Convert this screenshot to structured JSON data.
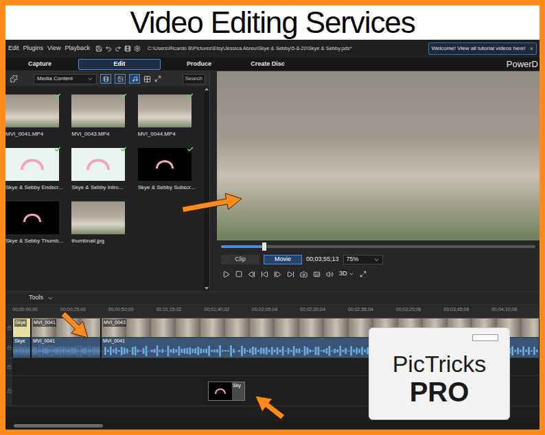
{
  "banner": {
    "title": "Video Editing Services"
  },
  "menu": [
    "Edit",
    "Plugins",
    "View",
    "Playback"
  ],
  "project_path": "C:\\Users\\Ricardo B\\Pictures\\Etsy\\Jessica Abreu\\Skye & Sebby\\5-8-20\\Skye & Sebby.pds*",
  "notification": {
    "text": "Welcome! View all tutorial videos here!",
    "close": "×"
  },
  "tabs": [
    {
      "label": "Capture",
      "selected": false
    },
    {
      "label": "Edit",
      "selected": true
    },
    {
      "label": "Produce",
      "selected": false
    },
    {
      "label": "Create Disc",
      "selected": false
    }
  ],
  "brand": "PowerD",
  "library": {
    "dropdown": "Media Content",
    "search": "Search",
    "items": [
      {
        "label": "MVI_0041.MP4",
        "kind": "photo",
        "checked": true
      },
      {
        "label": "MVI_0043.MP4",
        "kind": "photo",
        "checked": true
      },
      {
        "label": "MVI_0044.MP4",
        "kind": "photo",
        "checked": true
      },
      {
        "label": "Skye & Sebby Endscr...",
        "kind": "light",
        "checked": true
      },
      {
        "label": "Skye & Sebby Intro...",
        "kind": "light",
        "checked": true
      },
      {
        "label": "Skye & Sebby Subscr...",
        "kind": "dark",
        "checked": true
      },
      {
        "label": "Skye & Sebby Thumb...",
        "kind": "dark",
        "checked": false
      },
      {
        "label": "thumbnail.jpg",
        "kind": "photo",
        "checked": false
      }
    ]
  },
  "playback": {
    "level": 0.13,
    "modes": [
      {
        "label": "Clip",
        "selected": false
      },
      {
        "label": "Movie",
        "selected": true
      }
    ],
    "timecode": "00;03;55;13",
    "zoom": "75%",
    "three_d": "3D"
  },
  "timeline": {
    "tools": "Tools",
    "ruler": [
      "00;00;00;00",
      "00;00;25;00",
      "00;00;50;00",
      "00;01;15;02",
      "00;01;40;02",
      "00;02;05;04",
      "00;02;30;04",
      "00;02;55;04",
      "00;03;20;06",
      "00;03;45;06",
      "00;04;10;08"
    ],
    "tracks": [
      {
        "kind": "video",
        "clips": [
          {
            "label": "Skye"
          },
          {
            "label": "MVI_0041"
          },
          {
            "label": "MVI_0043"
          }
        ]
      },
      {
        "kind": "audio",
        "clips": [
          {
            "label": "Skye"
          },
          {
            "label": "MVI_0041"
          },
          {
            "label": "MVI_0041"
          }
        ]
      },
      {
        "kind": "empty",
        "clips": []
      },
      {
        "kind": "overlay",
        "clips": [
          {
            "label": "Sky"
          }
        ]
      }
    ]
  },
  "watermark": {
    "line1": "PicTricks",
    "line2": "PRO"
  }
}
